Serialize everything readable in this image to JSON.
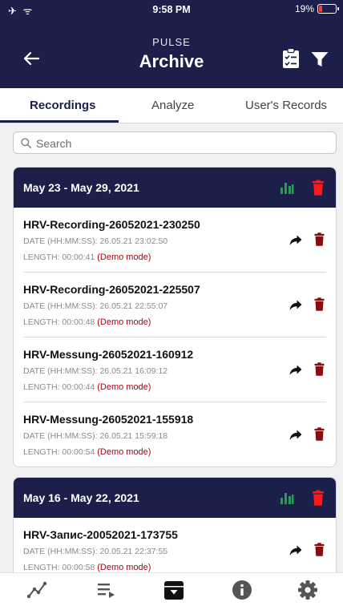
{
  "status": {
    "left": "✈ ᯤ",
    "time": "9:58 PM",
    "battery": "19%"
  },
  "header": {
    "subtitle": "PULSE",
    "title": "Archive"
  },
  "tabs": [
    {
      "label": "Recordings",
      "active": true
    },
    {
      "label": "Analyze",
      "active": false
    },
    {
      "label": "User's Records",
      "active": false
    }
  ],
  "search": {
    "placeholder": "Search"
  },
  "groups": [
    {
      "title": "May 23 - May 29, 2021",
      "records": [
        {
          "name": "HRV-Recording-26052021-230250",
          "date": "DATE (HH:MM:SS): 26.05.21 23:02:50",
          "length": "LENGTH: 00:00:41",
          "demo": "(Demo mode)"
        },
        {
          "name": "HRV-Recording-26052021-225507",
          "date": "DATE (HH:MM:SS): 26.05.21 22:55:07",
          "length": "LENGTH: 00:00:48",
          "demo": "(Demo mode)"
        },
        {
          "name": "HRV-Messung-26052021-160912",
          "date": "DATE (HH:MM:SS): 26.05.21 16:09:12",
          "length": "LENGTH: 00:00:44",
          "demo": "(Demo mode)"
        },
        {
          "name": "HRV-Messung-26052021-155918",
          "date": "DATE (HH:MM:SS): 26.05.21 15:59:18",
          "length": "LENGTH: 00:00:54",
          "demo": "(Demo mode)"
        }
      ]
    },
    {
      "title": "May 16 - May 22, 2021",
      "records": [
        {
          "name": "HRV-Запис-20052021-173755",
          "date": "DATE (HH:MM:SS): 20.05.21 22:37:55",
          "length": "LENGTH: 00:00:58",
          "demo": "(Demo mode)"
        }
      ]
    }
  ],
  "colors": {
    "header": "#1b1f4a",
    "delete": "#ff1a1a",
    "record_delete": "#8b0a0a",
    "chart": "#2e9a5a",
    "demo": "#b00012"
  },
  "icons": [
    "back-arrow-icon",
    "clipboard-check-icon",
    "filter-icon",
    "search-icon",
    "bar-chart-icon",
    "trash-icon",
    "share-icon",
    "trend-icon",
    "list-play-icon",
    "archive-icon",
    "info-icon",
    "gear-icon"
  ]
}
